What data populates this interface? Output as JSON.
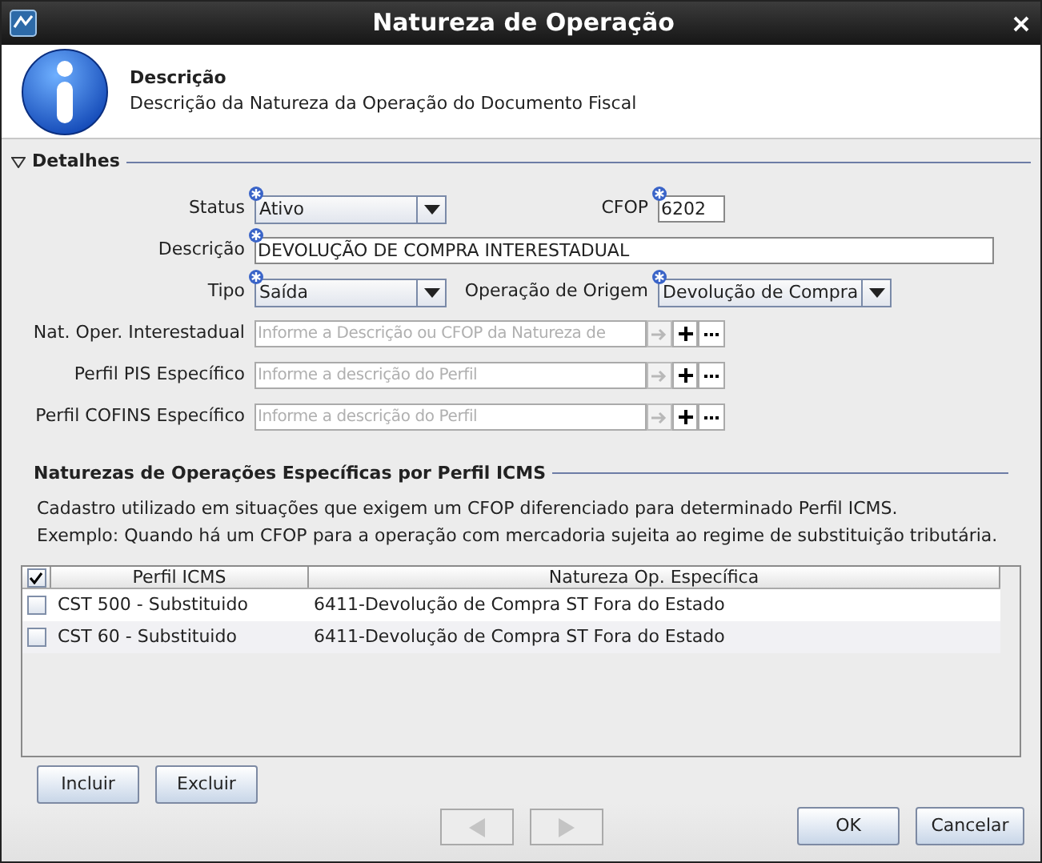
{
  "window": {
    "title": "Natureza de Operação"
  },
  "header": {
    "title": "Descrição",
    "subtitle": "Descrição da Natureza da Operação do Documento Fiscal"
  },
  "details": {
    "title": "Detalhes",
    "expanded": true,
    "rows": [
      [
        {
          "label": "Status",
          "kind": "combo",
          "value": "Ativo",
          "required": true
        },
        {
          "label": "CFOP",
          "kind": "text",
          "value": "6202",
          "required": true
        }
      ],
      [
        {
          "label": "Descrição",
          "kind": "text",
          "value": "DEVOLUÇÃO DE COMPRA INTERESTADUAL",
          "required": true
        }
      ],
      [
        {
          "label": "Tipo",
          "kind": "combo",
          "value": "Saída",
          "required": true
        },
        {
          "label": "Operação de Origem",
          "kind": "combo",
          "value": "Devolução de Compra",
          "required": true
        }
      ],
      [
        {
          "label": "Nat. Oper. Interestadual",
          "kind": "lookup",
          "placeholder": "Informe a Descrição ou CFOP da Natureza de",
          "required": false
        }
      ],
      [
        {
          "label": "Perfil PIS Específico",
          "kind": "lookup",
          "placeholder": "Informe a descrição do Perfil",
          "required": false
        }
      ],
      [
        {
          "label": "Perfil COFINS Específico",
          "kind": "lookup",
          "placeholder": "Informe a descrição do Perfil",
          "required": false
        }
      ]
    ]
  },
  "icms": {
    "title": "Naturezas de Operações Específicas por Perfil ICMS",
    "notes": [
      "Cadastro utilizado em situações que exigem um CFOP diferenciado para determinado Perfil ICMS.",
      "Exemplo: Quando há um CFOP para a operação com mercadoria sujeita ao regime de substituição tributária."
    ],
    "table": {
      "select_all_checked": true,
      "columns": [
        "Perfil ICMS",
        "Natureza Op. Específica"
      ],
      "rows": [
        {
          "checked": false,
          "cells": [
            "CST 500 - Substituido",
            "6411-Devolução de Compra ST Fora do Estado"
          ]
        },
        {
          "checked": false,
          "cells": [
            "CST 60 - Substituido",
            "6411-Devolução de Compra ST Fora do Estado"
          ]
        }
      ]
    },
    "buttons": [
      "Incluir",
      "Excluir"
    ]
  },
  "navigation": {
    "previous_disabled": true,
    "next_disabled": true
  },
  "buttons": [
    "OK",
    "Cancelar"
  ]
}
